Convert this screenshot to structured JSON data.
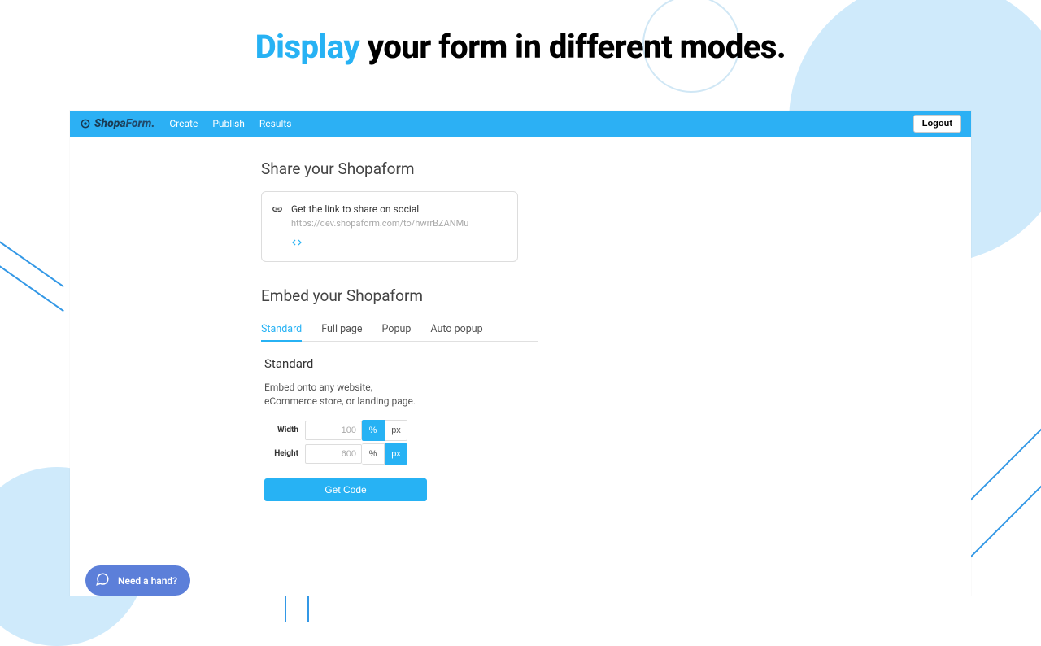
{
  "headline": {
    "accent": "Display",
    "rest": " your form in different modes."
  },
  "navbar": {
    "brand_shopa": "Shopa",
    "brand_form": "Form.",
    "links": [
      "Create",
      "Publish",
      "Results"
    ],
    "logout": "Logout"
  },
  "share": {
    "title": "Share your Shopaform",
    "label": "Get the link to share on social",
    "url": "https://dev.shopaform.com/to/hwrrBZANMu"
  },
  "embed": {
    "title": "Embed your Shopaform",
    "tabs": [
      "Standard",
      "Full page",
      "Popup",
      "Auto popup"
    ],
    "active_tab": 0,
    "standard": {
      "heading": "Standard",
      "desc": "Embed onto any website, eCommerce store, or landing page.",
      "width_label": "Width",
      "width_value": "100",
      "height_label": "Height",
      "height_value": "600",
      "percent": "%",
      "px": "px",
      "get_code": "Get Code"
    }
  },
  "chat": {
    "label": "Need a hand?"
  }
}
